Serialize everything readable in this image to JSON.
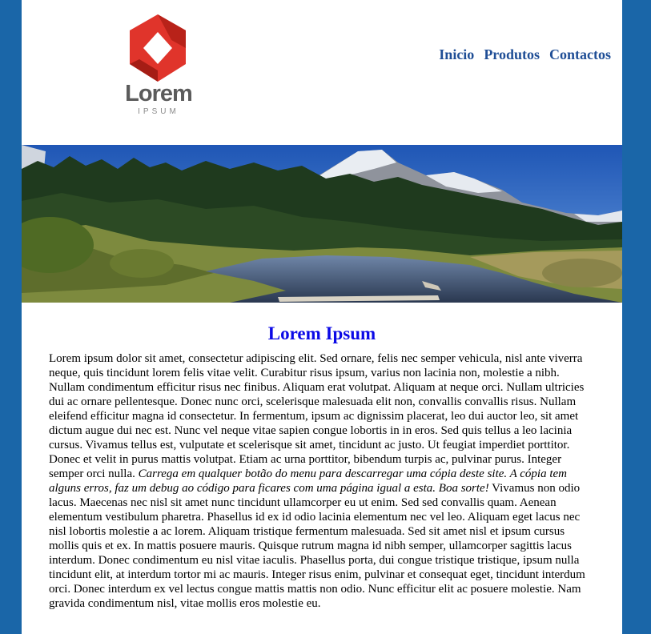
{
  "logo": {
    "title": "Lorem",
    "subtitle": "IPSUM"
  },
  "nav": {
    "items": [
      "Inicio",
      "Produtos",
      "Contactos"
    ]
  },
  "banner": {
    "alt": "Mountain landscape with river and forest"
  },
  "article": {
    "heading": "Lorem Ipsum",
    "text_before": "Lorem ipsum dolor sit amet, consectetur adipiscing elit. Sed ornare, felis nec semper vehicula, nisl ante viverra neque, quis tincidunt lorem felis vitae velit. Curabitur risus ipsum, varius non lacinia non, molestie a nibh. Nullam condimentum efficitur risus nec finibus. Aliquam erat volutpat. Aliquam at neque orci. Nullam ultricies dui ac ornare pellentesque. Donec nunc orci, scelerisque malesuada elit non, convallis convallis risus. Nullam eleifend efficitur magna id consectetur. In fermentum, ipsum ac dignissim placerat, leo dui auctor leo, sit amet dictum augue dui nec est. Nunc vel neque vitae sapien congue lobortis in in eros. Sed quis tellus a leo lacinia cursus. Vivamus tellus est, vulputate et scelerisque sit amet, tincidunt ac justo. Ut feugiat imperdiet porttitor. Donec et velit in purus mattis volutpat. Etiam ac urna porttitor, bibendum turpis ac, pulvinar purus. Integer semper orci nulla. ",
    "text_italic": "Carrega em qualquer botão do menu para descarregar uma cópia deste site. A cópia tem alguns erros, faz um debug ao código para ficares com uma página igual a esta. Boa sorte!",
    "text_after": " Vivamus non odio lacus. Maecenas nec nisl sit amet nunc tincidunt ullamcorper eu ut enim. Sed sed convallis quam. Aenean elementum vestibulum pharetra. Phasellus id ex id odio lacinia elementum nec vel leo. Aliquam eget lacus nec nisl lobortis molestie a ac lorem. Aliquam tristique fermentum malesuada. Sed sit amet nisl et ipsum cursus mollis quis et ex. In mattis posuere mauris. Quisque rutrum magna id nibh semper, ullamcorper sagittis lacus interdum. Donec condimentum eu nisl vitae iaculis. Phasellus porta, dui congue tristique tristique, ipsum nulla tincidunt elit, at interdum tortor mi ac mauris. Integer risus enim, pulvinar et consequat eget, tincidunt interdum orci. Donec interdum ex vel lectus congue mattis mattis non odio. Nunc efficitur elit ac posuere molestie. Nam gravida condimentum nisl, vitae mollis eros molestie eu."
  },
  "colors": {
    "side_background": "#1a66a8",
    "nav_link": "#1f4e96",
    "heading": "#0b09e6",
    "logo_red": "#e0342b"
  }
}
